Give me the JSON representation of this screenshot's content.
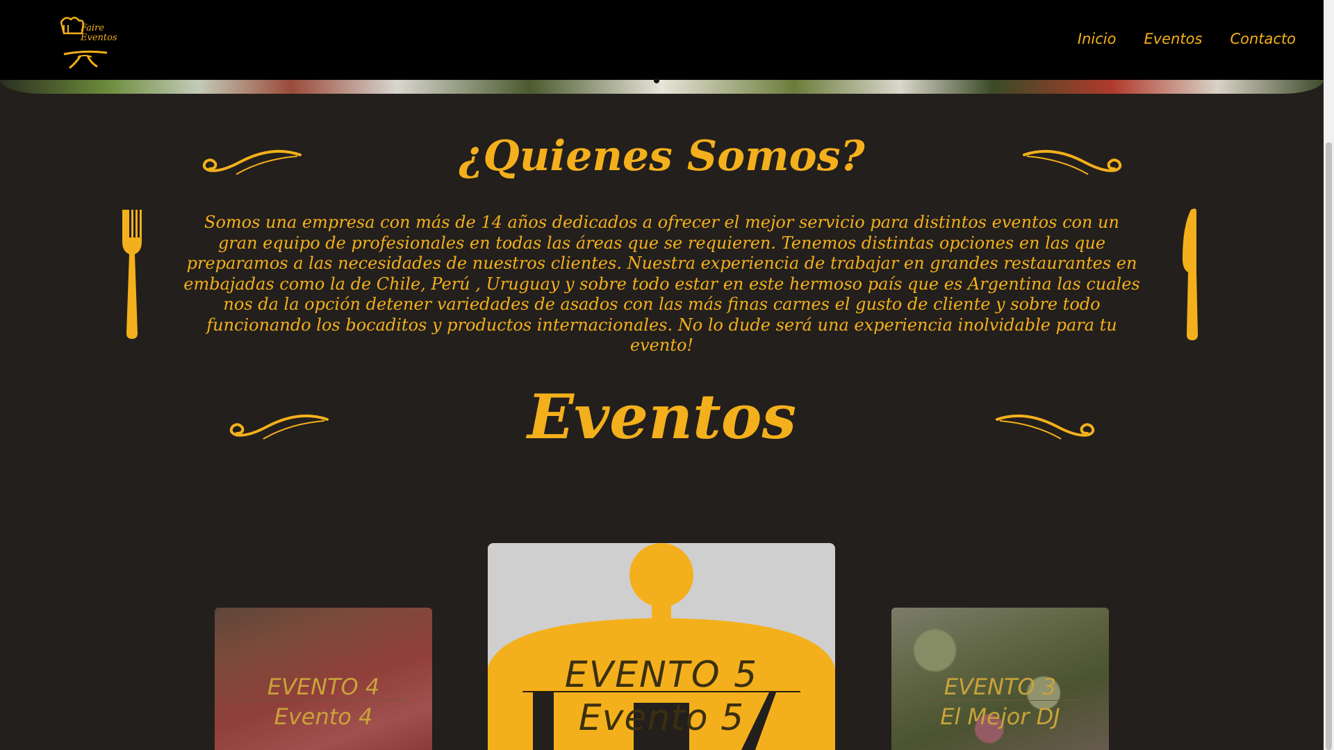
{
  "brand": {
    "logo_line1": "Faire",
    "logo_line2": "Eventos"
  },
  "nav": {
    "items": [
      {
        "label": "Inicio"
      },
      {
        "label": "Eventos"
      },
      {
        "label": "Contacto"
      }
    ]
  },
  "about": {
    "title": "¿Quienes Somos?",
    "paragraph": "Somos una empresa con más de 14 años dedicados a ofrecer el mejor servicio para distintos eventos con un gran equipo de profesionales en todas las áreas que se requieren. Tenemos distintas opciones en las que preparamos a las necesidades de nuestros clientes. Nuestra experiencia de trabajar en grandes restaurantes en embajadas como la de Chile, Perú , Uruguay y sobre todo estar en este hermoso país que es Argentina las cuales nos da la opción detener variedades de asados con las más finas carnes el gusto de cliente y sobre todo funcionando los bocaditos y productos internacionales. No lo dude será una experiencia inolvidable para tu evento!"
  },
  "events": {
    "title": "Eventos",
    "cards": [
      {
        "title": "EVENTO 4",
        "subtitle": "Evento 4"
      },
      {
        "title": "EVENTO 5",
        "subtitle": "Evento 5"
      },
      {
        "title": "EVENTO 3",
        "subtitle": "El Mejor DJ"
      }
    ]
  },
  "colors": {
    "accent": "#f4b01c",
    "background": "#231f1c",
    "navbar": "#000000"
  },
  "icons": [
    "chef-hat-logo-icon",
    "swirl-ornament-icon",
    "fork-icon",
    "knife-icon",
    "cloche-icon"
  ]
}
